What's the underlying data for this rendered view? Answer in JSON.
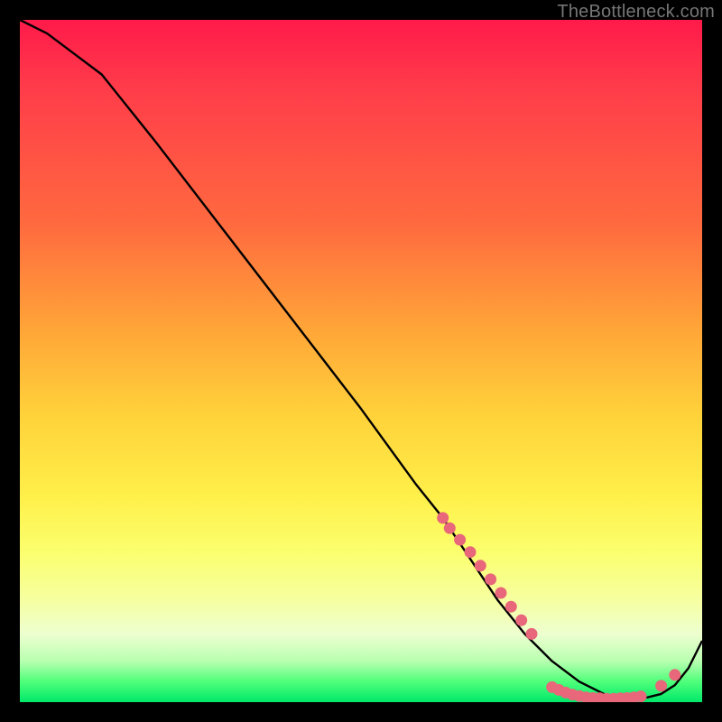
{
  "watermark": "TheBottleneck.com",
  "chart_data": {
    "type": "line",
    "title": "",
    "xlabel": "",
    "ylabel": "",
    "xlim": [
      0,
      100
    ],
    "ylim": [
      0,
      100
    ],
    "grid": false,
    "legend": false,
    "series": [
      {
        "name": "curve",
        "x": [
          0,
          4,
          8,
          12,
          20,
          30,
          40,
          50,
          58,
          62,
          66,
          70,
          74,
          78,
          82,
          86,
          88,
          90,
          92,
          94,
          96,
          98,
          100
        ],
        "y": [
          100,
          98,
          95,
          92,
          82,
          69,
          56,
          43,
          32,
          27,
          21,
          15,
          10,
          6,
          3,
          1,
          0.5,
          0.5,
          0.7,
          1.2,
          2.5,
          5,
          9
        ]
      }
    ],
    "markers": [
      {
        "name": "cluster-left",
        "x": [
          62,
          63,
          64.5,
          66,
          67.5,
          69,
          70.5,
          72,
          73.5,
          75
        ],
        "y": [
          27,
          25.5,
          23.8,
          22,
          20,
          18,
          16,
          14,
          12,
          10
        ]
      },
      {
        "name": "cluster-floor",
        "x": [
          78,
          79,
          80,
          81,
          82,
          83,
          84,
          85,
          86,
          87,
          88,
          89,
          90,
          91
        ],
        "y": [
          2.2,
          1.8,
          1.4,
          1.1,
          0.9,
          0.7,
          0.6,
          0.55,
          0.5,
          0.5,
          0.55,
          0.6,
          0.7,
          0.85
        ]
      },
      {
        "name": "cluster-right",
        "x": [
          94,
          96
        ],
        "y": [
          2.4,
          4.0
        ]
      }
    ],
    "colors": {
      "line": "#000000",
      "marker_fill": "#e9677a",
      "marker_stroke": "#e9677a"
    }
  }
}
